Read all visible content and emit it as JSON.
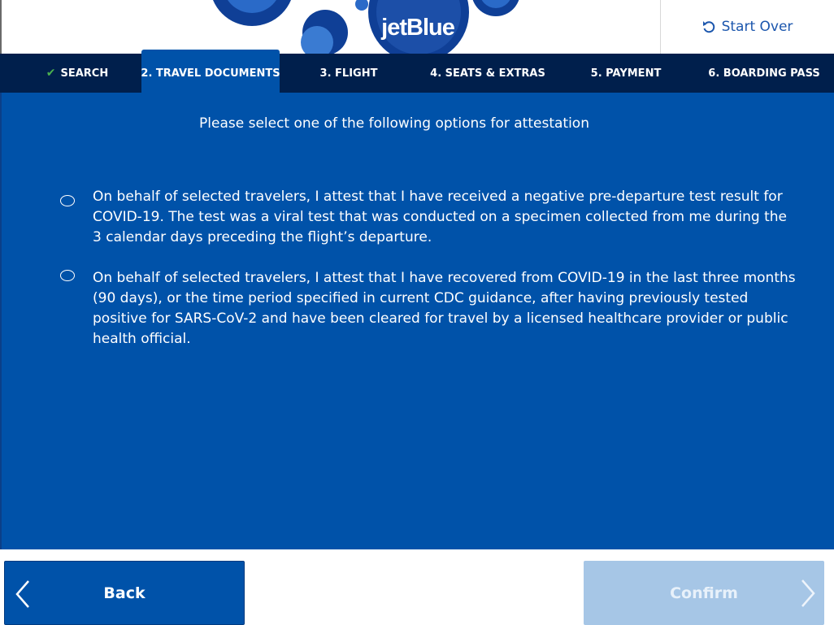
{
  "header": {
    "logo_text": "jetBlue",
    "start_over_label": "Start Over"
  },
  "nav": {
    "steps": [
      {
        "label": "SEARCH",
        "state": "completed"
      },
      {
        "label": "2. TRAVEL DOCUMENTS",
        "state": "active"
      },
      {
        "label": "3. FLIGHT",
        "state": "upcoming"
      },
      {
        "label": "4. SEATS & EXTRAS",
        "state": "upcoming"
      },
      {
        "label": "5. PAYMENT",
        "state": "upcoming"
      },
      {
        "label": "6. BOARDING PASS",
        "state": "upcoming"
      }
    ]
  },
  "main": {
    "prompt": "Please select one of the following options for attestation",
    "options": [
      {
        "text": "On behalf of selected travelers, I attest that I have received a negative pre-departure test result for COVID-19. The test was a viral test that was conducted on a specimen collected from me during the 3 calendar days preceding the flight’s departure.",
        "selected": false
      },
      {
        "text": "On behalf of selected travelers, I attest that I have recovered from COVID-19 in the last three months (90 days), or the time period specified in current CDC guidance, after having previously tested positive for SARS-CoV-2 and have been cleared for travel by a licensed healthcare provider or public health official.",
        "selected": false
      }
    ]
  },
  "footer": {
    "back_label": "Back",
    "confirm_label": "Confirm",
    "confirm_enabled": false
  },
  "colors": {
    "brand_blue": "#0052a9",
    "nav_navy": "#001f4c",
    "check_green": "#4bb04f",
    "disabled_button": "#a6c6e6"
  },
  "icons": {
    "start_over": "refresh-icon",
    "completed_step": "checkmark-icon",
    "back": "chevron-left-icon",
    "confirm": "chevron-right-icon"
  }
}
